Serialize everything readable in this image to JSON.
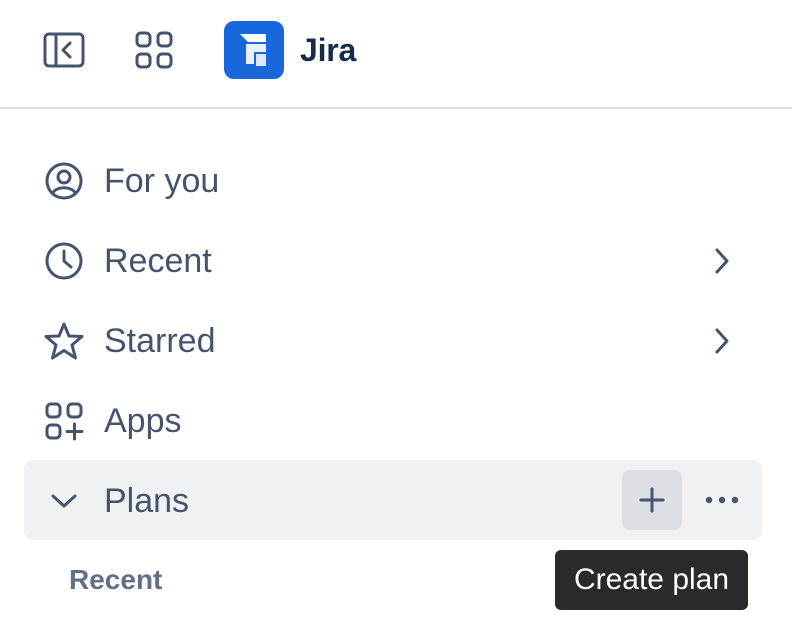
{
  "header": {
    "sidebar_toggle_icon": "sidebar-collapse-icon",
    "app_switcher_icon": "app-grid-icon",
    "logo_icon": "jira-logo-icon",
    "app_title": "Jira",
    "brand_color": "#1868db"
  },
  "nav": {
    "items": [
      {
        "label": "For you",
        "icon": "user-circle-icon",
        "expandable": false
      },
      {
        "label": "Recent",
        "icon": "clock-icon",
        "expandable": true
      },
      {
        "label": "Starred",
        "icon": "star-icon",
        "expandable": true
      },
      {
        "label": "Apps",
        "icon": "apps-add-icon",
        "expandable": false
      },
      {
        "label": "Plans",
        "icon": "chevron-down-icon",
        "expanded": true,
        "hovered": true
      }
    ],
    "plans_actions": {
      "add_icon": "plus-icon",
      "more_icon": "more-horizontal-icon"
    }
  },
  "plans_section": {
    "sub_heading": "Recent"
  },
  "tooltip": {
    "text": "Create plan"
  },
  "colors": {
    "text": "#44546f",
    "title": "#172b4d",
    "hover_bg": "#f0f1f2",
    "button_bg": "#dcdfe4",
    "tooltip_bg": "#292a2e"
  }
}
